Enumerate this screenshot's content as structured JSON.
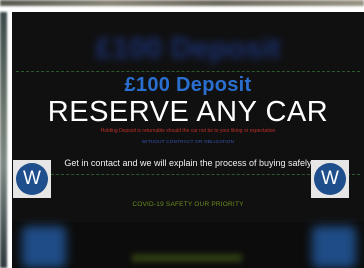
{
  "banner": {
    "ghost_title": "£100 Deposit",
    "deposit_heading": "£100 Deposit",
    "main_heading": "RESERVE ANY CAR",
    "holding_note": "Holding Deposit is returnable should the car not be to your liking or expectation",
    "without_obligation": "WITHOUT CONTRACT OR OBLIGATION",
    "contact_line": "Get in contact and we will explain the process of buying safely",
    "covid_line": "COVID-19 SAFETY OUR PRIORITY"
  },
  "badges": {
    "left_letter": "W",
    "right_letter": "W"
  },
  "colors": {
    "panel_bg": "#101010",
    "deposit_blue": "#2a6fd0",
    "holding_red": "#c0302a",
    "covid_green": "#6a8c1e",
    "badge_blue": "#1f4e8c"
  }
}
